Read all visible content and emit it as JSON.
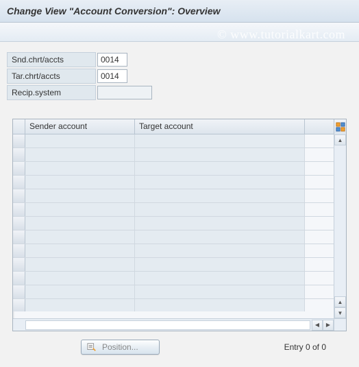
{
  "title": "Change View \"Account Conversion\": Overview",
  "watermark": "© www.tutorialkart.com",
  "form": {
    "snd_label": "Snd.chrt/accts",
    "snd_value": "0014",
    "tar_label": "Tar.chrt/accts",
    "tar_value": "0014",
    "recip_label": "Recip.system",
    "recip_value": ""
  },
  "table": {
    "col_sender": "Sender account",
    "col_target": "Target account",
    "rows": [
      {
        "sender": "",
        "target": ""
      },
      {
        "sender": "",
        "target": ""
      },
      {
        "sender": "",
        "target": ""
      },
      {
        "sender": "",
        "target": ""
      },
      {
        "sender": "",
        "target": ""
      },
      {
        "sender": "",
        "target": ""
      },
      {
        "sender": "",
        "target": ""
      },
      {
        "sender": "",
        "target": ""
      },
      {
        "sender": "",
        "target": ""
      },
      {
        "sender": "",
        "target": ""
      },
      {
        "sender": "",
        "target": ""
      },
      {
        "sender": "",
        "target": ""
      },
      {
        "sender": "",
        "target": ""
      }
    ]
  },
  "footer": {
    "position_label": "Position...",
    "entry_text": "Entry 0 of 0"
  }
}
